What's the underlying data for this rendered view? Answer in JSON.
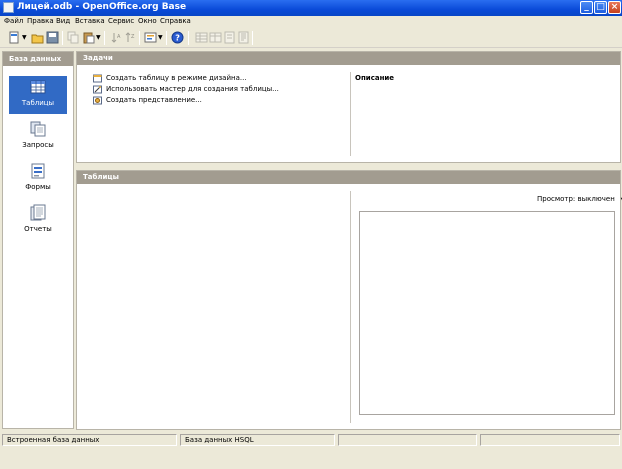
{
  "window": {
    "title": "Лицей.odb - OpenOffice.org Base"
  },
  "menu": [
    "Файл",
    "Правка",
    "Вид",
    "Вставка",
    "Сервис",
    "Окно",
    "Справка"
  ],
  "left_panel": {
    "header": "База данных",
    "items": [
      {
        "label": "Таблицы",
        "icon": "tables-icon",
        "selected": true
      },
      {
        "label": "Запросы",
        "icon": "queries-icon",
        "selected": false
      },
      {
        "label": "Формы",
        "icon": "forms-icon",
        "selected": false
      },
      {
        "label": "Отчеты",
        "icon": "reports-icon",
        "selected": false
      }
    ]
  },
  "tasks": {
    "header": "Задачи",
    "items": [
      "Создать таблицу в режиме дизайна...",
      "Использовать мастер для создания таблицы...",
      "Создать представление..."
    ],
    "description_title": "Описание"
  },
  "tables": {
    "header": "Таблицы",
    "preview_label": "Просмотр: выключен"
  },
  "status": [
    "Встроенная база данных",
    "База данных HSQL",
    "",
    ""
  ],
  "colors": {
    "selection": "#316ac5",
    "header_bar": "#a29c90",
    "titlebar": "#0a4ad8"
  }
}
